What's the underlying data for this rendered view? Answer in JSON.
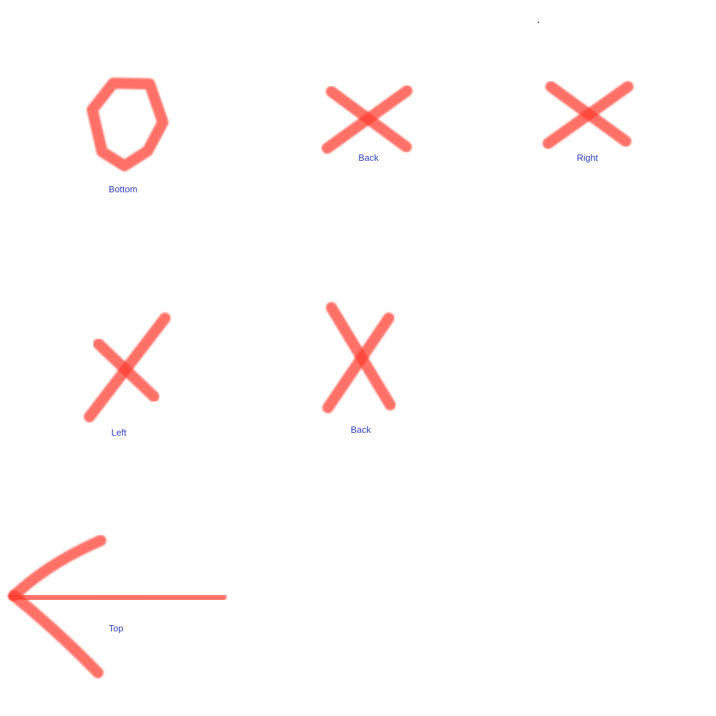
{
  "colors": {
    "stroke": "#ff3b2f",
    "label": "#2f3fb8",
    "background": "#ffffff",
    "dot": "#333333"
  },
  "marks": [
    {
      "shape": "heptagon",
      "label": "Bottom"
    },
    {
      "shape": "x-mark",
      "label": "Back"
    },
    {
      "shape": "x-mark",
      "label": "Right"
    },
    {
      "shape": "x-mark",
      "label": "Left"
    },
    {
      "shape": "x-mark",
      "label": "Back"
    },
    {
      "shape": "left-arrow",
      "label": "Top"
    }
  ]
}
